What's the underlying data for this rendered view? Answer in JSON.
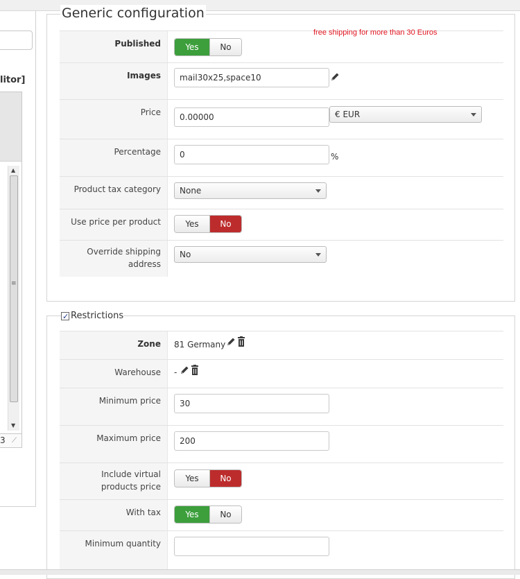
{
  "note": "free shipping for more than 30 Euros",
  "left_panel": {
    "editor_label": "litor]",
    "line_number": "3"
  },
  "generic": {
    "legend": "Generic configuration",
    "published": {
      "label": "Published",
      "yes": "Yes",
      "no": "No",
      "selected": "Yes"
    },
    "images": {
      "label": "Images",
      "value": "mail30x25,space10"
    },
    "price": {
      "label": "Price",
      "value": "0.00000",
      "currency": "€ EUR"
    },
    "percentage": {
      "label": "Percentage",
      "value": "0",
      "unit": "%"
    },
    "tax_category": {
      "label": "Product tax category",
      "value": "None"
    },
    "price_per_product": {
      "label": "Use price per product",
      "yes": "Yes",
      "no": "No",
      "selected": "No"
    },
    "override_shipping": {
      "label_line1": "Override shipping",
      "label_line2": "address",
      "value": "No"
    }
  },
  "restrictions": {
    "legend": "Restrictions",
    "checked": true,
    "zone": {
      "label": "Zone",
      "value": "81 Germany"
    },
    "warehouse": {
      "label": "Warehouse",
      "value": "-"
    },
    "min_price": {
      "label": "Minimum price",
      "value": "30"
    },
    "max_price": {
      "label": "Maximum price",
      "value": "200"
    },
    "include_virtual": {
      "label_line1": "Include virtual",
      "label_line2": "products price",
      "yes": "Yes",
      "no": "No",
      "selected": "No"
    },
    "with_tax": {
      "label": "With tax",
      "yes": "Yes",
      "no": "No",
      "selected": "Yes"
    },
    "min_quantity": {
      "label": "Minimum quantity",
      "value": ""
    }
  },
  "colors": {
    "yes_active": "#3c9f3c",
    "no_active": "#bd2c2c",
    "note": "#e0141e"
  }
}
